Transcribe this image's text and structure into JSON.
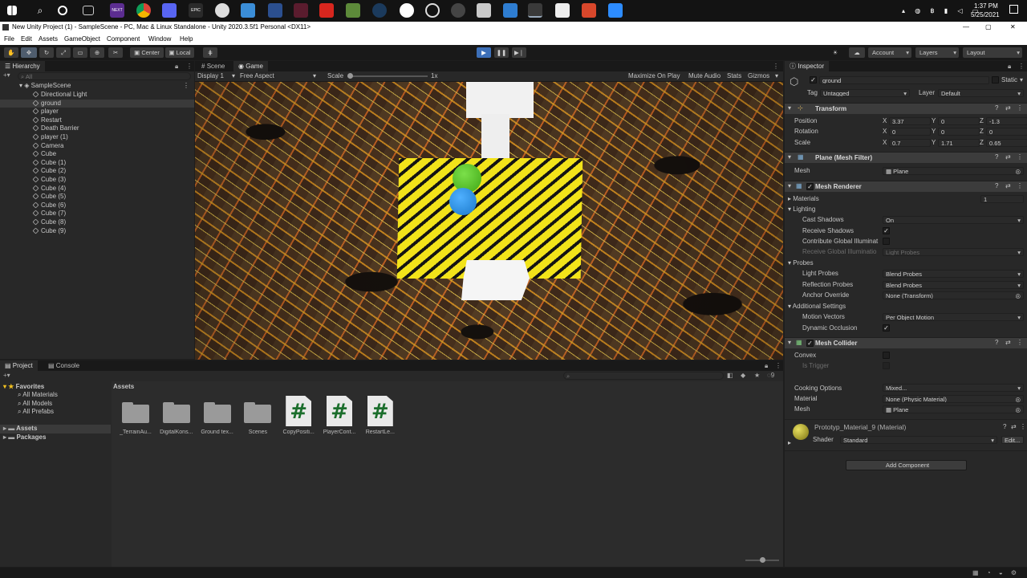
{
  "taskbar": {
    "app_icons": [
      "windows-logo",
      "search-icon",
      "task-view-icon",
      "taskbar-apps-icon",
      "next-app-icon",
      "chrome-icon",
      "discord-icon",
      "epic-games-icon",
      "obs-icon",
      "facebook-icon",
      "app-6-icon",
      "app-v-icon",
      "acrobat-icon",
      "minecraft-icon",
      "steam-icon",
      "xbox-icon",
      "app-gear-icon",
      "app-g-icon",
      "photos-icon",
      "app-blue-icon",
      "unity-icon",
      "app-white-icon",
      "app-red-icon",
      "zoom-icon"
    ],
    "next_label": "NEXT",
    "epic_label": "EPIC",
    "time": "1:37 PM",
    "date": "5/25/2021"
  },
  "window": {
    "title": "New Unity Project (1) - SampleScene - PC, Mac & Linux Standalone - Unity 2020.3.5f1 Personal <DX11>"
  },
  "menu": [
    "File",
    "Edit",
    "Assets",
    "GameObject",
    "Component",
    "Window",
    "Help"
  ],
  "toolbar": {
    "pivot": "Center",
    "space": "Local",
    "account": "Account",
    "layers": "Layers",
    "layout": "Layout"
  },
  "hierarchy": {
    "tab": "Hierarchy",
    "search_placeholder": "All",
    "scene": "SampleScene",
    "items": [
      "Directional Light",
      "ground",
      "player",
      "Restart",
      "Death Barrier",
      "player (1)",
      "Camera",
      "Cube",
      "Cube (1)",
      "Cube (2)",
      "Cube (3)",
      "Cube (4)",
      "Cube (5)",
      "Cube (6)",
      "Cube (7)",
      "Cube (8)",
      "Cube (9)"
    ],
    "selected_index": 1
  },
  "game_view": {
    "tabs": [
      "Scene",
      "Game"
    ],
    "active_tab": "Game",
    "display": "Display 1",
    "aspect": "Free Aspect",
    "scale_label": "Scale",
    "scale_value": "1x",
    "toggles": [
      "Maximize On Play",
      "Mute Audio",
      "Stats",
      "Gizmos"
    ]
  },
  "project": {
    "tabs": [
      "Project",
      "Console"
    ],
    "favorites_label": "Favorites",
    "favorites": [
      "All Materials",
      "All Models",
      "All Prefabs"
    ],
    "roots": [
      "Assets",
      "Packages"
    ],
    "breadcrumb": "Assets",
    "hidden_count": "9",
    "assets": [
      {
        "name": "_TerrainAu...",
        "type": "folder"
      },
      {
        "name": "DigitalKons...",
        "type": "folder"
      },
      {
        "name": "Ground tex...",
        "type": "folder"
      },
      {
        "name": "Scenes",
        "type": "folder"
      },
      {
        "name": "CopyPositi...",
        "type": "script"
      },
      {
        "name": "PlayerCont...",
        "type": "script"
      },
      {
        "name": "RestartLe...",
        "type": "script"
      }
    ],
    "script_glyph": "#"
  },
  "inspector": {
    "tab": "Inspector",
    "object_name": "ground",
    "static_label": "Static",
    "tag_label": "Tag",
    "tag": "Untagged",
    "layer_label": "Layer",
    "layer": "Default",
    "transform": {
      "title": "Transform",
      "rows": [
        {
          "label": "Position",
          "x": "3.37",
          "y": "0",
          "z": "-1.3"
        },
        {
          "label": "Rotation",
          "x": "0",
          "y": "0",
          "z": "0"
        },
        {
          "label": "Scale",
          "x": "0.7",
          "y": "1.71",
          "z": "0.65"
        }
      ]
    },
    "mesh_filter": {
      "title": "Plane (Mesh Filter)",
      "mesh_label": "Mesh",
      "mesh": "Plane"
    },
    "mesh_renderer": {
      "title": "Mesh Renderer",
      "materials_label": "Materials",
      "materials_count": "1",
      "lighting_label": "Lighting",
      "cast_shadows_label": "Cast Shadows",
      "cast_shadows": "On",
      "receive_shadows_label": "Receive Shadows",
      "contribute_gi_label": "Contribute Global Illuminat",
      "receive_gi_label": "Receive Global Illuminatio",
      "receive_gi": "Light Probes",
      "probes_label": "Probes",
      "light_probes_label": "Light Probes",
      "light_probes": "Blend Probes",
      "reflection_probes_label": "Reflection Probes",
      "reflection_probes": "Blend Probes",
      "anchor_label": "Anchor Override",
      "anchor": "None (Transform)",
      "additional_label": "Additional Settings",
      "motion_vectors_label": "Motion Vectors",
      "motion_vectors": "Per Object Motion",
      "dynamic_occlusion_label": "Dynamic Occlusion"
    },
    "mesh_collider": {
      "title": "Mesh Collider",
      "convex_label": "Convex",
      "trigger_label": "Is Trigger",
      "cooking_label": "Cooking Options",
      "cooking": "Mixed...",
      "material_label": "Material",
      "material": "None (Physic Material)",
      "mesh_label": "Mesh",
      "mesh": "Plane"
    },
    "material": {
      "title": "Prototyp_Material_9 (Material)",
      "shader_label": "Shader",
      "shader": "Standard",
      "edit": "Edit..."
    },
    "add_component": "Add Component"
  },
  "colors": {
    "accent": "#4d7bc2",
    "selection": "#2c5d87",
    "game_blue": "#2a8fd9",
    "game_green": "#52c41a",
    "stripe_yellow": "#f2e31a"
  }
}
